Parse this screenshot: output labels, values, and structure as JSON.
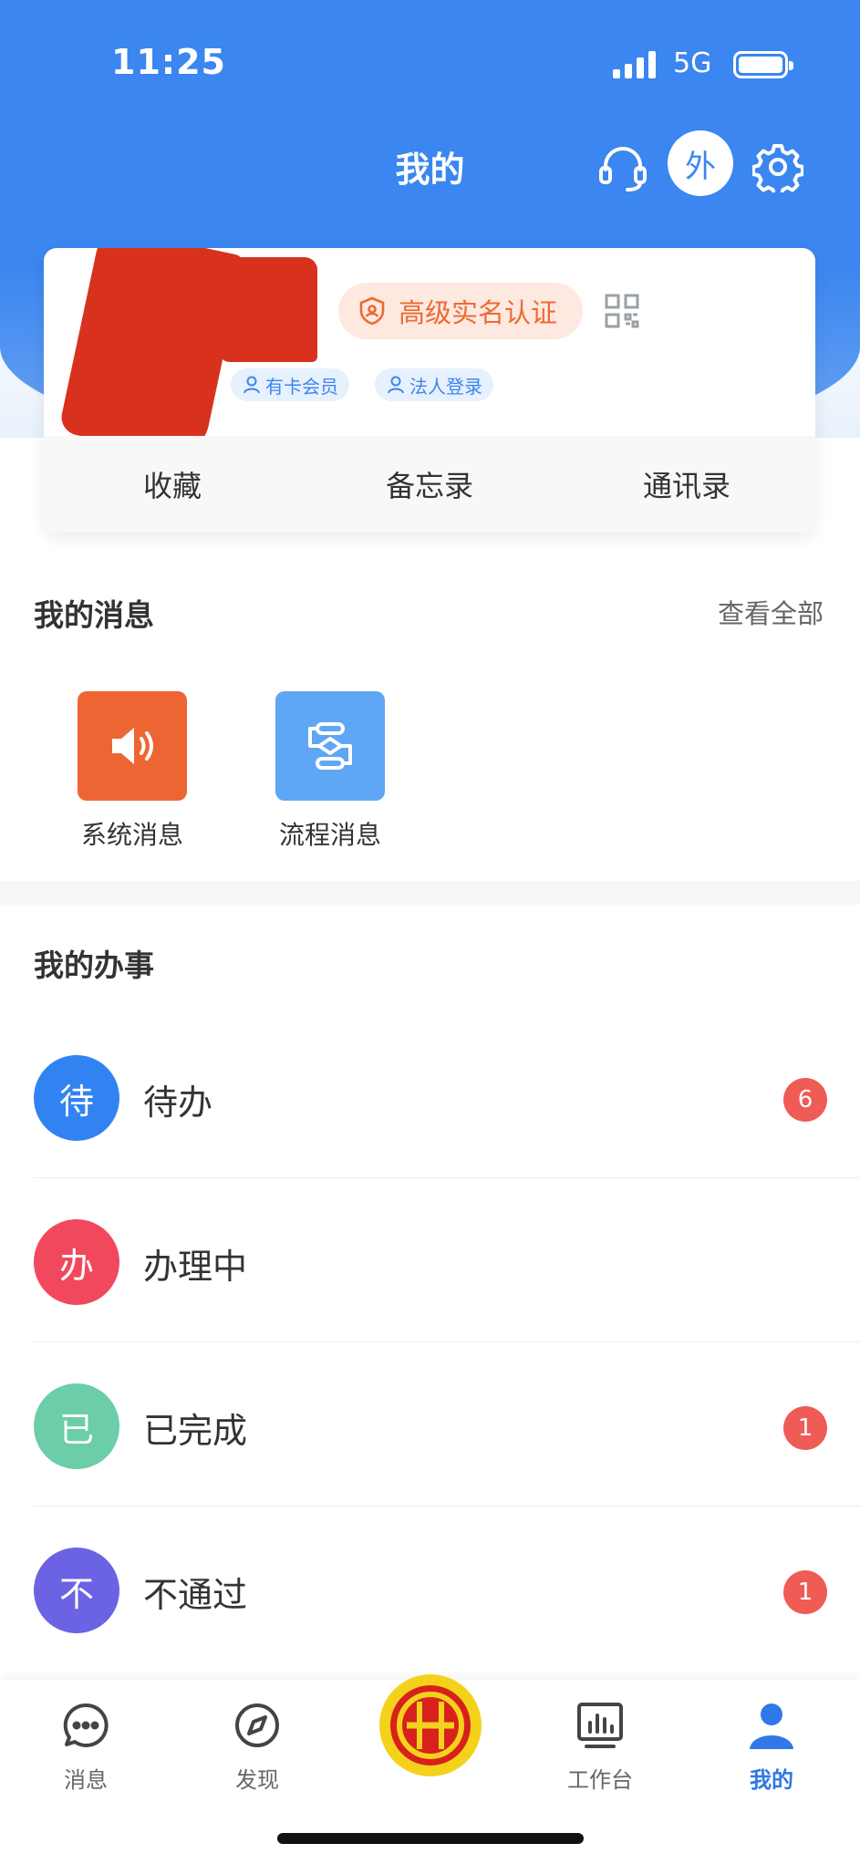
{
  "status_bar": {
    "time": "11:25",
    "network": "5G"
  },
  "nav": {
    "title": "我的",
    "external_label": "外"
  },
  "profile": {
    "certification": "高级实名认证",
    "tags": [
      "有卡会员",
      "法人登录"
    ],
    "actions": [
      "收藏",
      "备忘录",
      "通讯录"
    ]
  },
  "messages": {
    "title": "我的消息",
    "view_all": "查看全部",
    "items": [
      {
        "label": "系统消息",
        "icon": "speaker-icon",
        "color": "#ee6534"
      },
      {
        "label": "流程消息",
        "icon": "flow-icon",
        "color": "#5fa6f4"
      }
    ]
  },
  "tasks": {
    "title": "我的办事",
    "items": [
      {
        "char": "待",
        "label": "待办",
        "count": "6",
        "color": "#3183f2"
      },
      {
        "char": "办",
        "label": "办理中",
        "count": "",
        "color": "#f1485e"
      },
      {
        "char": "已",
        "label": "已完成",
        "count": "1",
        "color": "#6ccda9"
      },
      {
        "char": "不",
        "label": "不通过",
        "count": "1",
        "color": "#6b63e3"
      }
    ]
  },
  "tabbar": {
    "items": [
      {
        "label": "消息",
        "icon": "chat-icon"
      },
      {
        "label": "发现",
        "icon": "compass-icon"
      },
      {
        "label": "",
        "icon": "union-logo-icon"
      },
      {
        "label": "工作台",
        "icon": "dashboard-icon"
      },
      {
        "label": "我的",
        "icon": "person-icon",
        "active": true
      }
    ]
  },
  "colors": {
    "brand": "#3b86f0",
    "active_tab": "#2f78e6",
    "badge": "#ef5b55"
  }
}
